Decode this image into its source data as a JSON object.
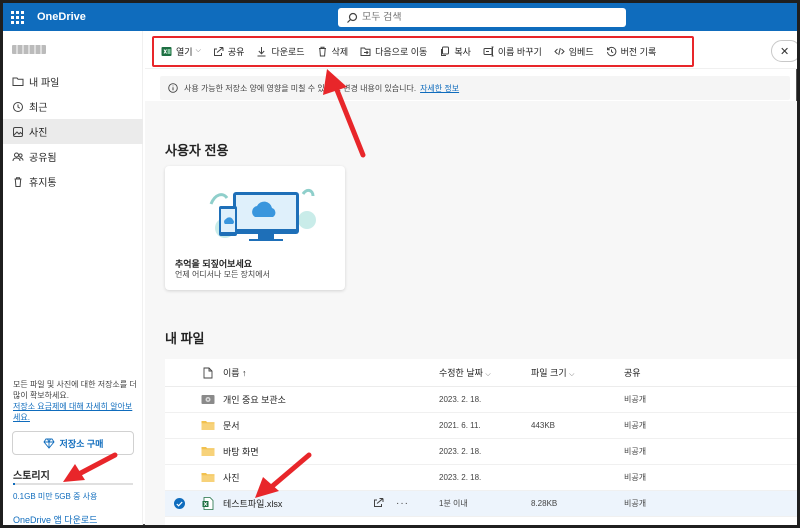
{
  "app": {
    "title": "OneDrive"
  },
  "search": {
    "placeholder": "모두 검색"
  },
  "sidebar": {
    "nav": [
      {
        "label": "내 파일",
        "icon": "folder-icon"
      },
      {
        "label": "최근",
        "icon": "clock-icon"
      },
      {
        "label": "사진",
        "icon": "photo-icon"
      },
      {
        "label": "공유됨",
        "icon": "people-icon"
      },
      {
        "label": "휴지통",
        "icon": "trash-icon"
      }
    ],
    "storage_note": "모든 파일 및 사진에 대한 저장소를 더 많이 확보하세요.",
    "storage_link": "저장소 요금제에 대해 자세히 알아보세요.",
    "buy_label": "저장소 구매",
    "storage_title": "스토리지",
    "storage_usage": "0.1GB 미만 5GB 중 사용",
    "storage_fill_fraction": 0.02,
    "download_app": "OneDrive 앱 다운로드"
  },
  "commands": [
    {
      "label": "열기",
      "icon": "excel-icon",
      "dropdown": true
    },
    {
      "label": "공유",
      "icon": "share-icon"
    },
    {
      "label": "다운로드",
      "icon": "download-icon"
    },
    {
      "label": "삭제",
      "icon": "trash-icon"
    },
    {
      "label": "다음으로 이동",
      "icon": "move-icon"
    },
    {
      "label": "복사",
      "icon": "copy-icon"
    },
    {
      "label": "이름 바꾸기",
      "icon": "rename-icon"
    },
    {
      "label": "임베드",
      "icon": "embed-icon"
    },
    {
      "label": "버전 기록",
      "icon": "history-icon"
    }
  ],
  "banner": {
    "text": "사용 가능한 저장소 양에 영향을 미칠 수 있는 ... 변경 내용이 있습니다.",
    "link": "자세한 정보"
  },
  "sections": {
    "personal": "사용자 전용",
    "my_files": "내 파일"
  },
  "card": {
    "title": "추억을 되짚어보세요",
    "subtitle": "언제 어디서나 모든 장치에서"
  },
  "table": {
    "headers": {
      "name": "이름 ↑",
      "modified": "수정한 날짜",
      "size": "파일 크기",
      "sharing": "공유"
    },
    "rows": [
      {
        "name": "개인 중요 보관소",
        "type": "vault",
        "modified": "2023. 2. 18.",
        "size": "",
        "sharing": "비공개",
        "selected": false
      },
      {
        "name": "문서",
        "type": "folder",
        "modified": "2021. 6. 11.",
        "size": "443KB",
        "sharing": "비공개",
        "selected": false
      },
      {
        "name": "바탕 화면",
        "type": "folder",
        "modified": "2023. 2. 18.",
        "size": "",
        "sharing": "비공개",
        "selected": false
      },
      {
        "name": "사진",
        "type": "folder",
        "modified": "2023. 2. 18.",
        "size": "",
        "sharing": "비공개",
        "selected": false
      },
      {
        "name": "테스트파일.xlsx",
        "type": "excel",
        "modified": "1분 이내",
        "size": "8.28KB",
        "sharing": "비공개",
        "selected": true
      }
    ]
  },
  "colors": {
    "brand": "#0f6cbd",
    "highlight": "#e8262a",
    "folder": "#f2c14e",
    "excel": "#1d6f42"
  }
}
